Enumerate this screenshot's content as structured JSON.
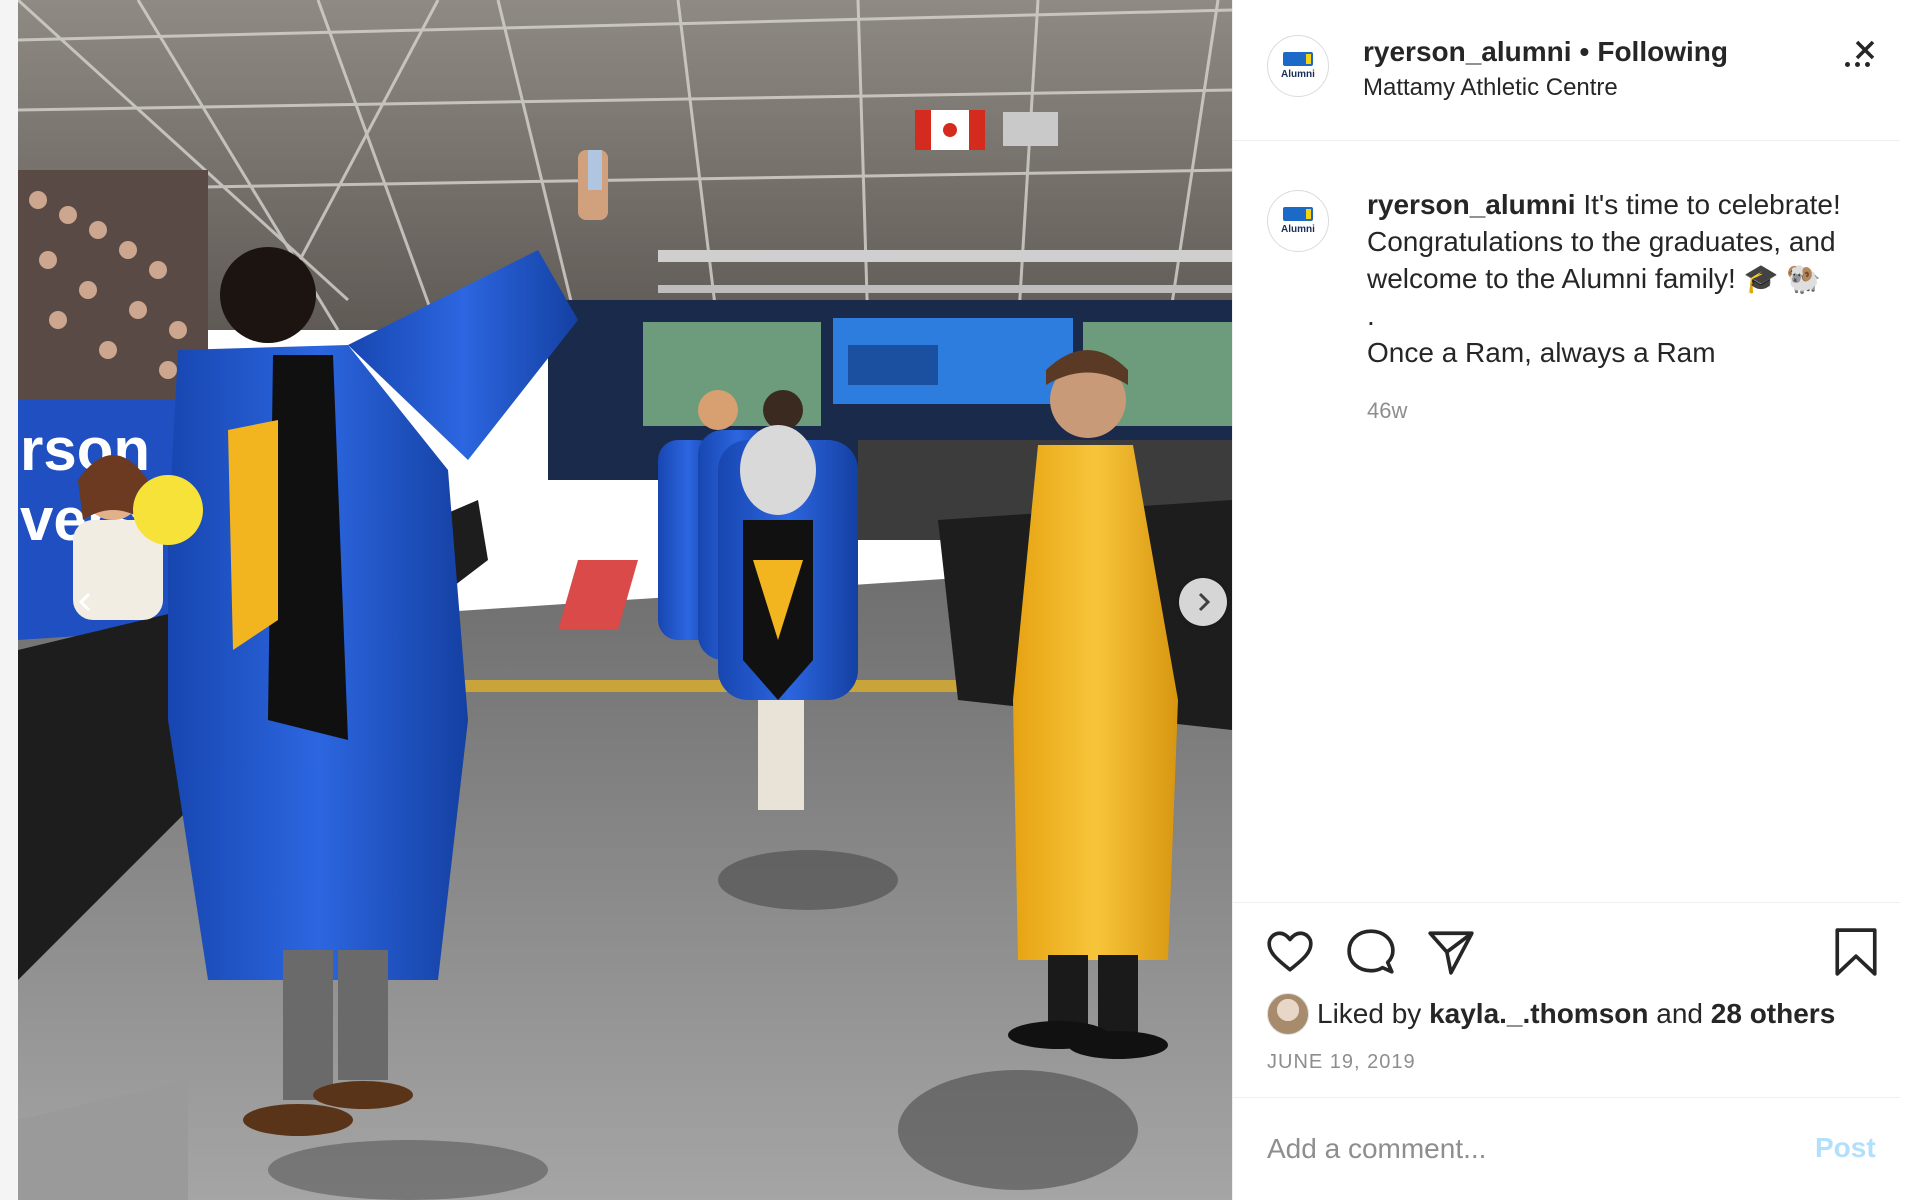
{
  "header": {
    "username": "ryerson_alumni",
    "separator": "•",
    "follow_status": "Following",
    "location": "Mattamy Athletic Centre",
    "avatar_text": "Alumni"
  },
  "caption": {
    "username": "ryerson_alumni",
    "line1": "It's time to celebrate! Congratulations to the graduates, and welcome to the Alumni family! 🎓 🐏",
    "line2": ".",
    "line3": "Once a Ram, always a Ram",
    "time_ago": "46w"
  },
  "photo": {
    "description_icons": [
      "chevron-left-icon",
      "chevron-right-icon"
    ]
  },
  "actions": {
    "liked_by_prefix": "Liked by",
    "liked_by_user": "kayla._.thomson",
    "liked_and": "and",
    "liked_others": "28 others",
    "date": "JUNE 19, 2019"
  },
  "comment": {
    "placeholder": "Add a comment...",
    "post_label": "Post"
  },
  "icons": {
    "like": "heart-icon",
    "comment": "comment-bubble-icon",
    "share": "paper-plane-icon",
    "save": "bookmark-icon",
    "more": "more-dots-icon",
    "close": "close-icon"
  },
  "colors": {
    "gown_blue": "#1e56c8",
    "gown_gold": "#f2b51f",
    "post_button": "#b2dffc",
    "muted_text": "#8e8e8e"
  }
}
